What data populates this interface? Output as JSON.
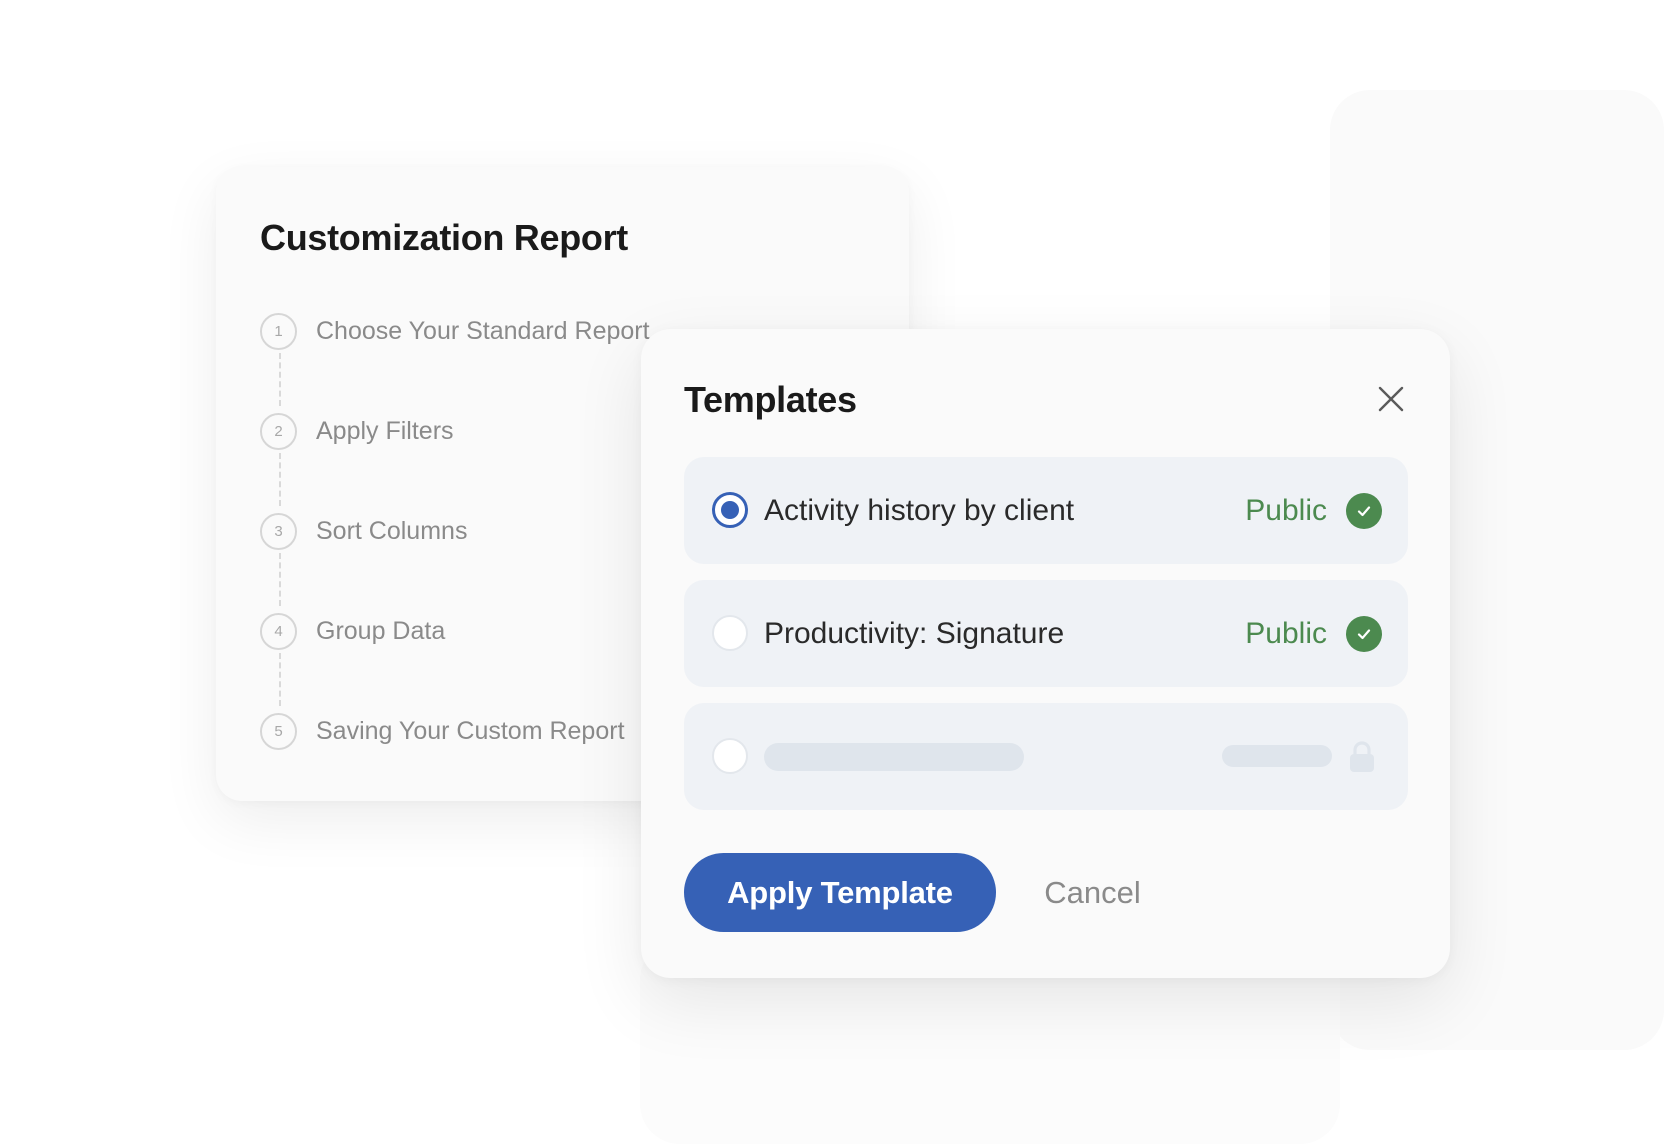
{
  "report": {
    "title": "Customization Report",
    "steps": [
      {
        "number": "1",
        "label": "Choose Your Standard Report"
      },
      {
        "number": "2",
        "label": "Apply Filters"
      },
      {
        "number": "3",
        "label": "Sort Columns"
      },
      {
        "number": "4",
        "label": "Group Data"
      },
      {
        "number": "5",
        "label": "Saving Your Custom Report"
      }
    ]
  },
  "templates": {
    "title": "Templates",
    "close_icon": "close-icon",
    "options": [
      {
        "name": "Activity history by client",
        "status": "Public",
        "selected": true,
        "status_icon": "check-circle-icon"
      },
      {
        "name": "Productivity: Signature",
        "status": "Public",
        "selected": false,
        "status_icon": "check-circle-icon"
      },
      {
        "name": "",
        "status": "",
        "selected": false,
        "status_icon": "lock-icon",
        "placeholder": true
      }
    ],
    "apply_label": "Apply Template",
    "cancel_label": "Cancel"
  },
  "colors": {
    "accent": "#3661b6",
    "public_green": "#4c8a4f",
    "option_background": "#eff2f6"
  }
}
